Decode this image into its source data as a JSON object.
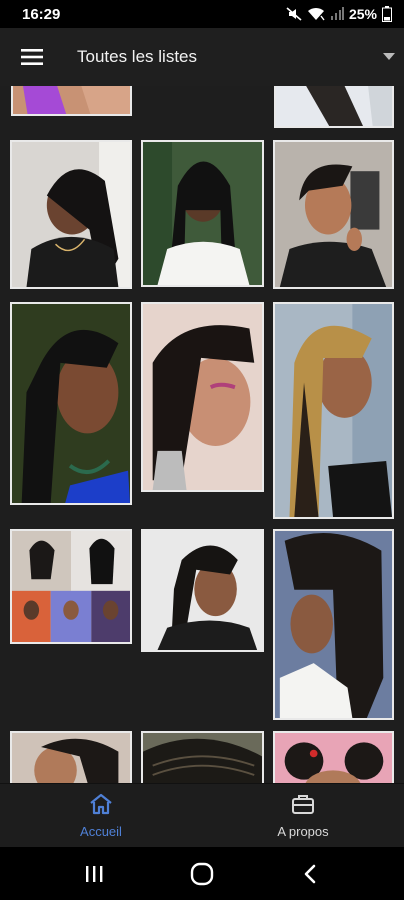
{
  "status": {
    "time": "16:29",
    "battery": "25%"
  },
  "app_bar": {
    "title": "Toutes les listes",
    "menu_icon": "hamburger-menu-icon",
    "dropdown_icon": "dropdown-arrow-icon"
  },
  "gallery": {
    "image_count": 15
  },
  "bottom_nav": {
    "home_label": "Accueil",
    "about_label": "A propos",
    "active_color": "#4f80d6",
    "inactive_color": "#d8d8d8"
  },
  "system_nav": {
    "recents_icon": "recent-apps-icon",
    "home_icon": "home-circle-icon",
    "back_icon": "back-chevron-icon"
  }
}
